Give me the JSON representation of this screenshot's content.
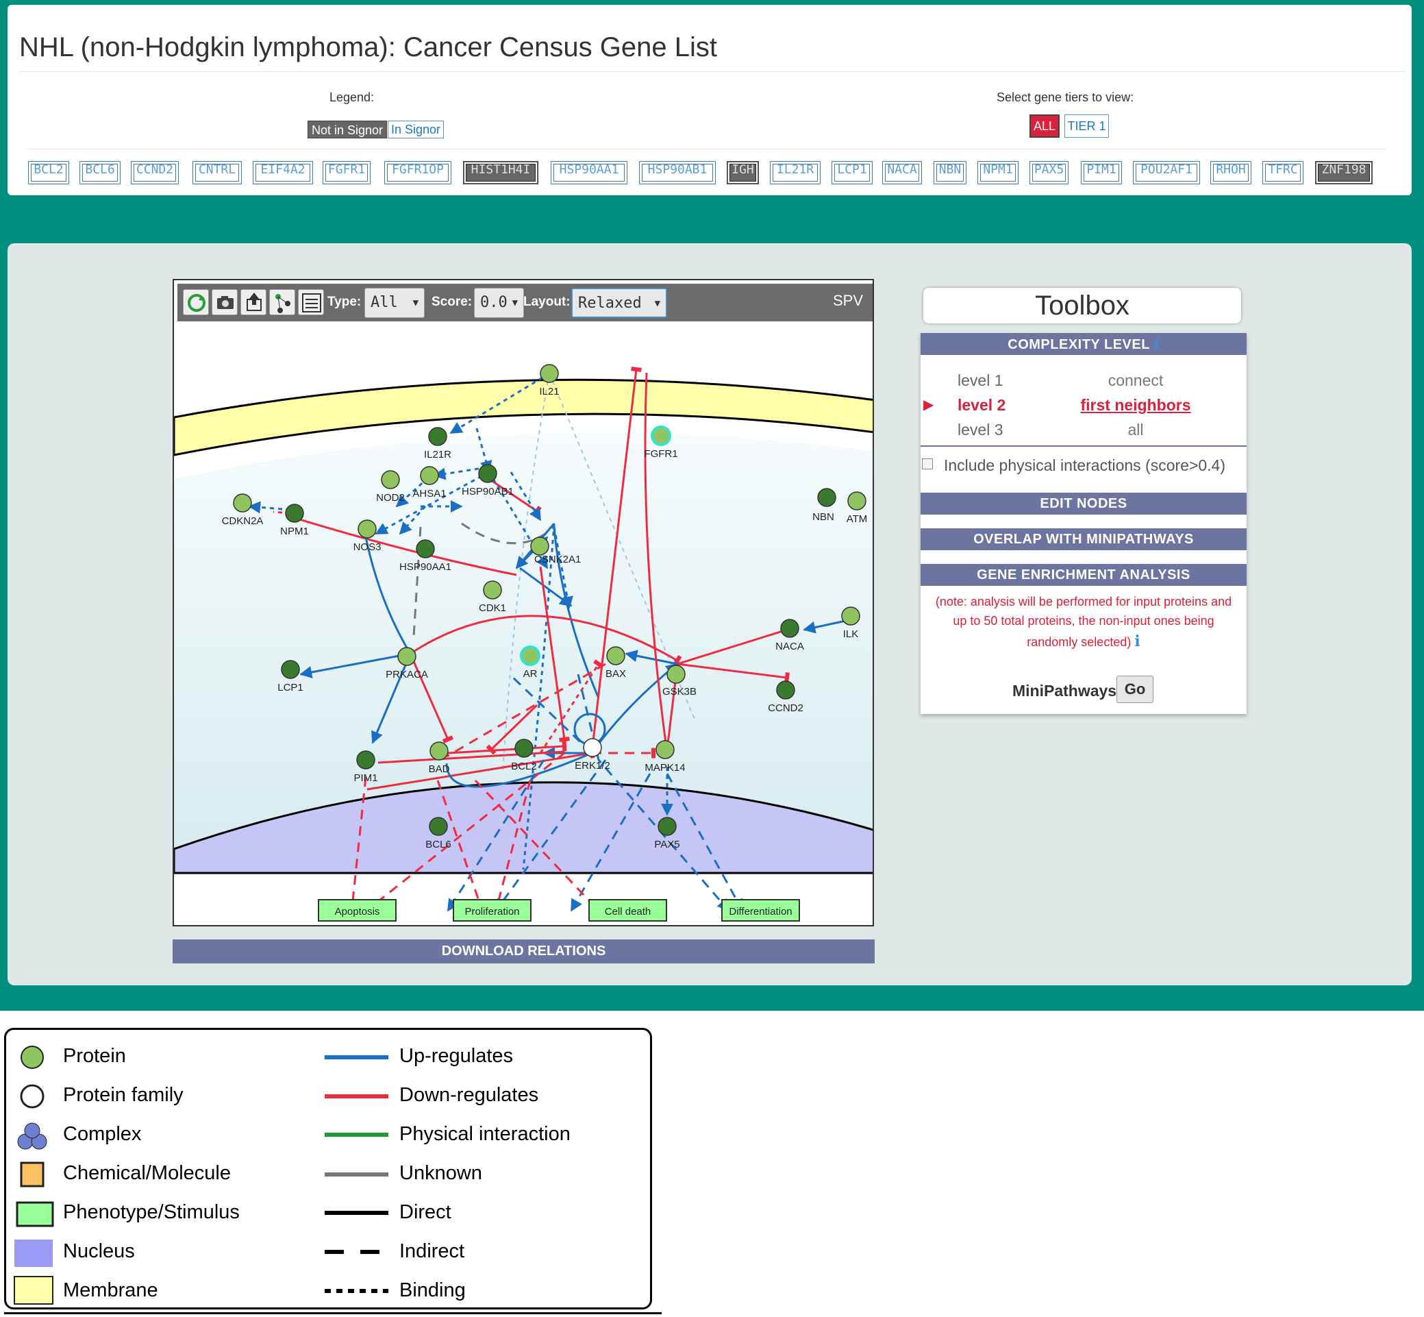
{
  "header": {
    "title": "NHL (non-Hodgkin lymphoma): Cancer Census Gene List",
    "legend_caption": "Legend:",
    "legend_not_in_signor": "Not in Signor",
    "legend_in_signor": "In Signor",
    "tiers_caption": "Select gene tiers to view:",
    "tier_all": "ALL",
    "tier_1": "TIER 1"
  },
  "genes": [
    "BCL2",
    "BCL6",
    "CCND2",
    "CNTRL",
    "EIF4A2",
    "FGFR1",
    "FGFR1OP",
    "HIST1H4I",
    "HSP90AA1",
    "HSP90AB1",
    "IGH",
    "IL21R",
    "LCP1",
    "NACA",
    "NBN",
    "NPM1",
    "PAX5",
    "PIM1",
    "POU2AF1",
    "RHOH",
    "TFRC",
    "ZNF198"
  ],
  "genes_not_in_signor": [
    "HIST1H4I",
    "IGH",
    "ZNF198"
  ],
  "toolbar": {
    "type_label": "Type:",
    "type_value": "All",
    "score_label": "Score:",
    "score_value": "0.0",
    "layout_label": "Layout:",
    "layout_value": "Relaxed",
    "spv": "SPV"
  },
  "network": {
    "nodes": [
      "IL21",
      "IL21R",
      "FGFR1",
      "NOD2",
      "AHSA1",
      "HSP90AB1",
      "CDKN2A",
      "NPM1",
      "NBN",
      "ATM",
      "NOS3",
      "HSP90AA1",
      "CSNK2A1",
      "CDK1",
      "NACA",
      "ILK",
      "LCP1",
      "PRKACA",
      "AR",
      "BAX",
      "GSK3B",
      "CCND2",
      "PIM1",
      "BAD",
      "BCL2",
      "ERK1/2",
      "MAPK14",
      "BCL6",
      "PAX5"
    ],
    "phenotypes": [
      "Apoptosis",
      "Proliferation",
      "Cell death",
      "Differentiation"
    ]
  },
  "download_label": "DOWNLOAD RELATIONS",
  "toolbox": {
    "title": "Toolbox",
    "complexity_header": "COMPLEXITY LEVEL",
    "levels": [
      {
        "name": "level 1",
        "desc": "connect"
      },
      {
        "name": "level 2",
        "desc": "first neighbors"
      },
      {
        "name": "level 3",
        "desc": "all"
      }
    ],
    "physical_checkbox": "Include physical interactions (score>0.4)",
    "edit_nodes": "EDIT NODES",
    "overlap": "OVERLAP WITH MINIPATHWAYS",
    "enrichment": "GENE ENRICHMENT ANALYSIS",
    "note_line1": "(note: analysis will be performed for input proteins and",
    "note_line2": "up to 50 total proteins, the non-input ones being",
    "note_line3": "randomly selected)",
    "minipathways": "MiniPathways",
    "go": "Go"
  },
  "legend": {
    "left": [
      "Protein",
      "Protein family",
      "Complex",
      "Chemical/Molecule",
      "Phenotype/Stimulus",
      "Nucleus",
      "Membrane"
    ],
    "right": [
      "Up-regulates",
      "Down-regulates",
      "Physical interaction",
      "Unknown",
      "Direct",
      "Indirect",
      "Binding"
    ]
  },
  "colors": {
    "teal": "#008e7f",
    "up": "#1a6fc4",
    "down": "#ef2b42",
    "physical": "#1f9a3b",
    "unknown": "#777777",
    "protein": "#8fc460",
    "protein_dark": "#3a7a2e",
    "phenotype": "#99ff99",
    "nucleus": "#c6c6f6",
    "membrane": "#ffffaa"
  }
}
